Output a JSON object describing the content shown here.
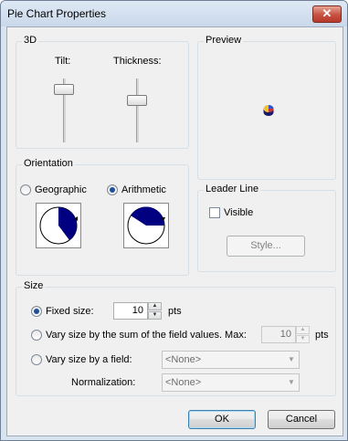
{
  "window": {
    "title": "Pie Chart Properties",
    "close_glyph": "✕"
  },
  "group_3d": {
    "label": "3D",
    "tilt_label": "Tilt:",
    "thickness_label": "Thickness:"
  },
  "preview": {
    "label": "Preview"
  },
  "orientation": {
    "label": "Orientation",
    "geographic_label": "Geographic",
    "arithmetic_label": "Arithmetic",
    "selected": "Arithmetic"
  },
  "leader_line": {
    "label": "Leader Line",
    "visible_label": "Visible",
    "visible_checked": false,
    "style_button": "Style..."
  },
  "size": {
    "label": "Size",
    "fixed_label": "Fixed size:",
    "fixed_value": "10",
    "fixed_unit": "pts",
    "vary_sum_label": "Vary size by the sum of the field values.  Max:",
    "vary_sum_value": "10",
    "vary_sum_unit": "pts",
    "vary_field_label": "Vary size by a field:",
    "field_value": "<None>",
    "normalization_label": "Normalization:",
    "normalization_value": "<None>",
    "selected": "Fixed size"
  },
  "buttons": {
    "ok": "OK",
    "cancel": "Cancel"
  },
  "colors": {
    "pie_fill": "#000080",
    "accent": "#1f4f9a"
  }
}
